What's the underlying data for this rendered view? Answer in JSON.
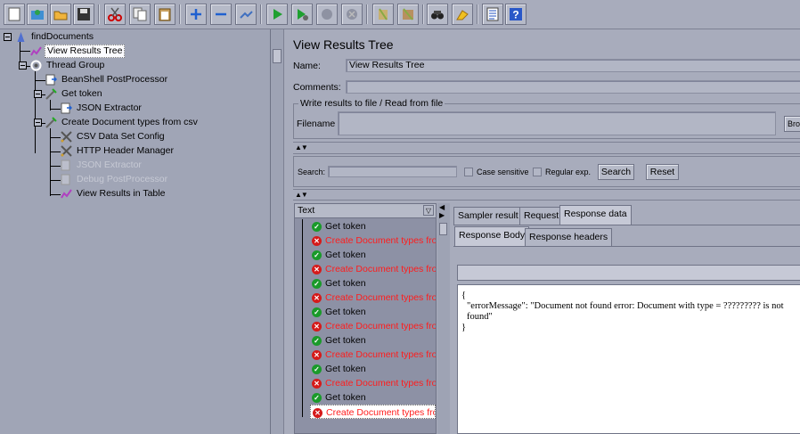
{
  "toolbar": {
    "icons": [
      "new-icon",
      "templates-icon",
      "open-icon",
      "save-icon",
      "cut-icon",
      "copy-icon",
      "paste-icon",
      "expand-icon",
      "collapse-icon",
      "toggle-icon",
      "start-icon",
      "start-no-pause-icon",
      "stop-icon",
      "shutdown-icon",
      "clear-icon",
      "clear-all-icon",
      "search-icon",
      "reset-search-icon",
      "function-helper-icon",
      "help-icon"
    ]
  },
  "tree": {
    "nodes": [
      {
        "label": "findDocuments",
        "icon": "test-plan-icon"
      },
      {
        "label": "View Results Tree",
        "icon": "listener-icon",
        "selected": true
      },
      {
        "label": "Thread Group",
        "icon": "thread-group-icon"
      },
      {
        "label": "BeanShell PostProcessor",
        "icon": "postprocessor-icon"
      },
      {
        "label": "Get token",
        "icon": "sampler-icon"
      },
      {
        "label": "JSON Extractor",
        "icon": "postprocessor-icon"
      },
      {
        "label": "Create Document types from csv",
        "icon": "sampler-icon"
      },
      {
        "label": "CSV Data Set Config",
        "icon": "config-icon"
      },
      {
        "label": "HTTP Header Manager",
        "icon": "config-icon"
      },
      {
        "label": "JSON Extractor",
        "icon": "postprocessor-icon",
        "disabled": true
      },
      {
        "label": "Debug PostProcessor",
        "icon": "postprocessor-icon",
        "disabled": true
      },
      {
        "label": "View Results in Table",
        "icon": "listener-icon"
      }
    ]
  },
  "panel": {
    "title": "View Results Tree",
    "name_label": "Name:",
    "name_value": "View Results Tree",
    "comments_label": "Comments:",
    "comments_value": "",
    "file_group_title": "Write results to file / Read from file",
    "filename_label": "Filename",
    "browse_label": "Bro"
  },
  "search": {
    "label": "Search:",
    "value": "",
    "case_sensitive": "Case sensitive",
    "regex": "Regular exp.",
    "search_button": "Search",
    "reset_button": "Reset"
  },
  "results": {
    "column": "Text",
    "rows": [
      {
        "text": "Get token",
        "status": "ok"
      },
      {
        "text": "Create Document types from",
        "status": "bad"
      },
      {
        "text": "Get token",
        "status": "ok"
      },
      {
        "text": "Create Document types from",
        "status": "bad"
      },
      {
        "text": "Get token",
        "status": "ok"
      },
      {
        "text": "Create Document types from",
        "status": "bad"
      },
      {
        "text": "Get token",
        "status": "ok"
      },
      {
        "text": "Create Document types from",
        "status": "bad"
      },
      {
        "text": "Get token",
        "status": "ok"
      },
      {
        "text": "Create Document types from",
        "status": "bad"
      },
      {
        "text": "Get token",
        "status": "ok"
      },
      {
        "text": "Create Document types from",
        "status": "bad"
      },
      {
        "text": "Get token",
        "status": "ok"
      },
      {
        "text": "Create Document types from",
        "status": "bad",
        "selected": true
      }
    ]
  },
  "tabs": {
    "sampler_result": "Sampler result",
    "request": "Request",
    "response_data": "Response data",
    "response_body": "Response Body",
    "response_headers": "Response headers"
  },
  "response": {
    "line1": "{",
    "line2": "\"errorMessage\": \"Document not found error: Document with type = ????????? is not found\"",
    "line3": "}"
  },
  "colors": {
    "error_text": "#ff1c1c",
    "ok_status": "#1a9a2a",
    "error_status": "#d51a1a"
  }
}
